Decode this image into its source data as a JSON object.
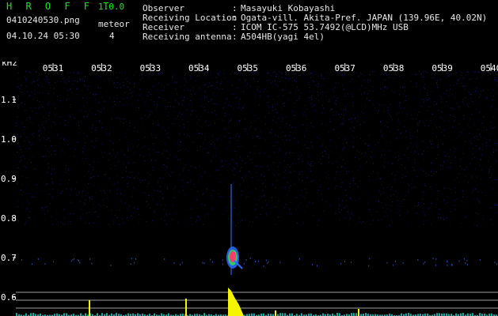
{
  "header": {
    "app_title": "H R O F F T",
    "app_version": "1.0.0",
    "file_name": "0410240530.png",
    "date_time": "04.10.24 05:30",
    "meteor_label": "meteor",
    "meteor_count": "4"
  },
  "info": [
    {
      "label": "Observer",
      "value": "Masayuki Kobayashi"
    },
    {
      "label": "Receiving Location",
      "value": "Ogata-vill. Akita-Pref. JAPAN (139.96E, 40.02N)"
    },
    {
      "label": "Receiver",
      "value": "ICOM IC-575 53.7492(@LCD)MHz USB"
    },
    {
      "label": "Receiving antenna",
      "value": "A504HB(yagi 4el)"
    }
  ],
  "colon": ":",
  "spectrogram": {
    "y_unit": "kHz",
    "time_labels": [
      "0531",
      "0532",
      "0533",
      "0534",
      "0535",
      "0536",
      "0537",
      "0538",
      "0539",
      "0540"
    ],
    "freq_labels": [
      "1.1",
      "1.0",
      "0.9",
      "0.8",
      "0.7",
      "0.6"
    ],
    "colors": {
      "noise": "#1a1a8c",
      "echo_hot": "#ff3b6b",
      "echo_mid": "#39d05a",
      "echo_cool": "#2b6cff",
      "amplitude": "#f5f500",
      "baseline": "#22d0d0",
      "guide_line": "#c8c8c8",
      "tick_marks": "#ffffff"
    }
  }
}
